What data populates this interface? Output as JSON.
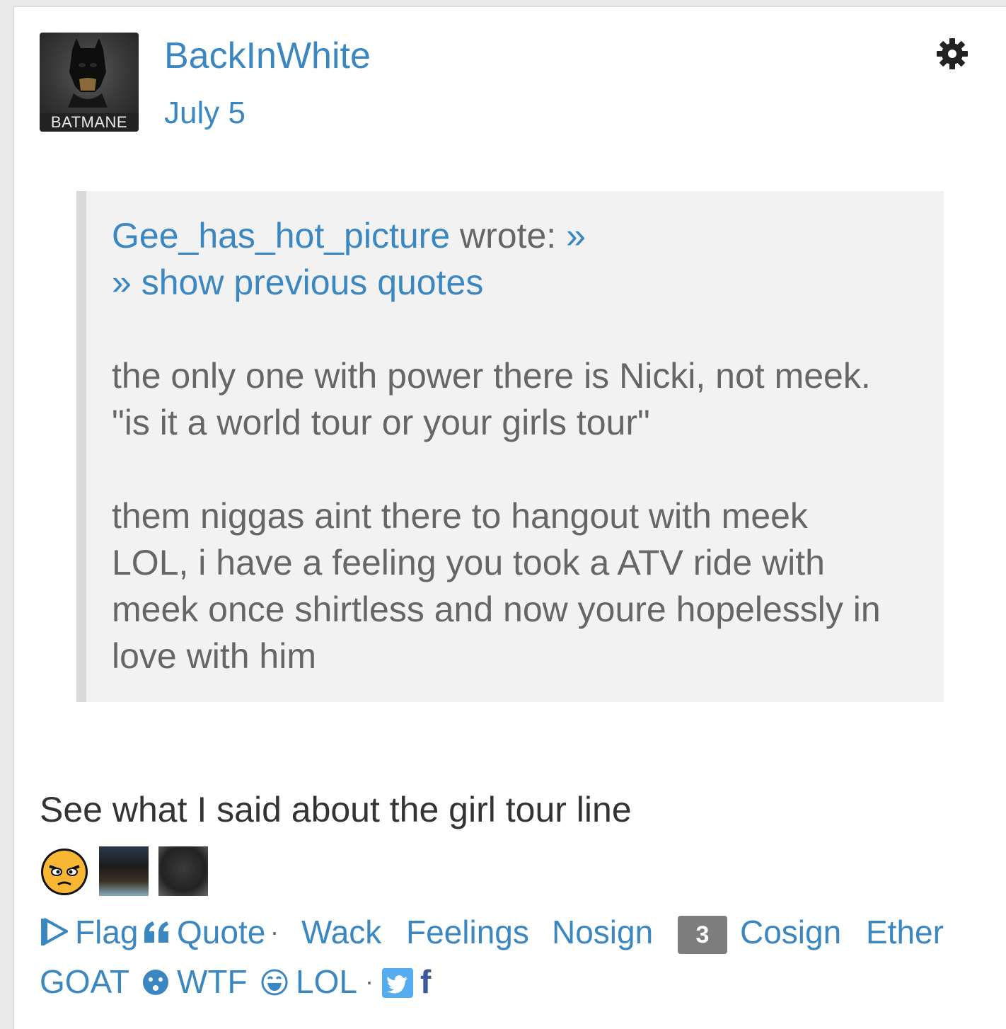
{
  "post": {
    "username": "BackInWhite",
    "date": "July 5",
    "avatar_caption": "BATMANE",
    "quote": {
      "author": "Gee_has_hot_picture",
      "wrote": " wrote: ",
      "arrow": "»",
      "show_previous": "» show previous quotes",
      "paragraphs": [
        "the only one with power there is Nicki, not meek.\n\"is it a world tour or your girls tour\"",
        "them niggas aint there to hangout with meek\nLOL, i have a feeling you took a ATV ride with\nmeek once shirtless and now youre hopelessly in\nlove with him"
      ]
    },
    "body": "See what I said about the girl tour line"
  },
  "reactors": [
    "angry-emoji",
    "user-avatar-1",
    "user-avatar-2"
  ],
  "actions": {
    "flag": "Flag",
    "quote": "Quote",
    "separator": "·",
    "wack": "Wack",
    "feelings": "Feelings",
    "nosign": "Nosign",
    "cosign_count": "3",
    "cosign": "Cosign",
    "ether": "Ether",
    "goat": "GOAT",
    "wtf": "WTF",
    "lol": "LOL",
    "facebook": "f"
  },
  "colors": {
    "link": "#3a87c2",
    "quote_bg": "#f2f2f2",
    "quote_border": "#dadada",
    "badge": "#7d7d7d",
    "twitter": "#55acee",
    "facebook": "#3b5998"
  }
}
